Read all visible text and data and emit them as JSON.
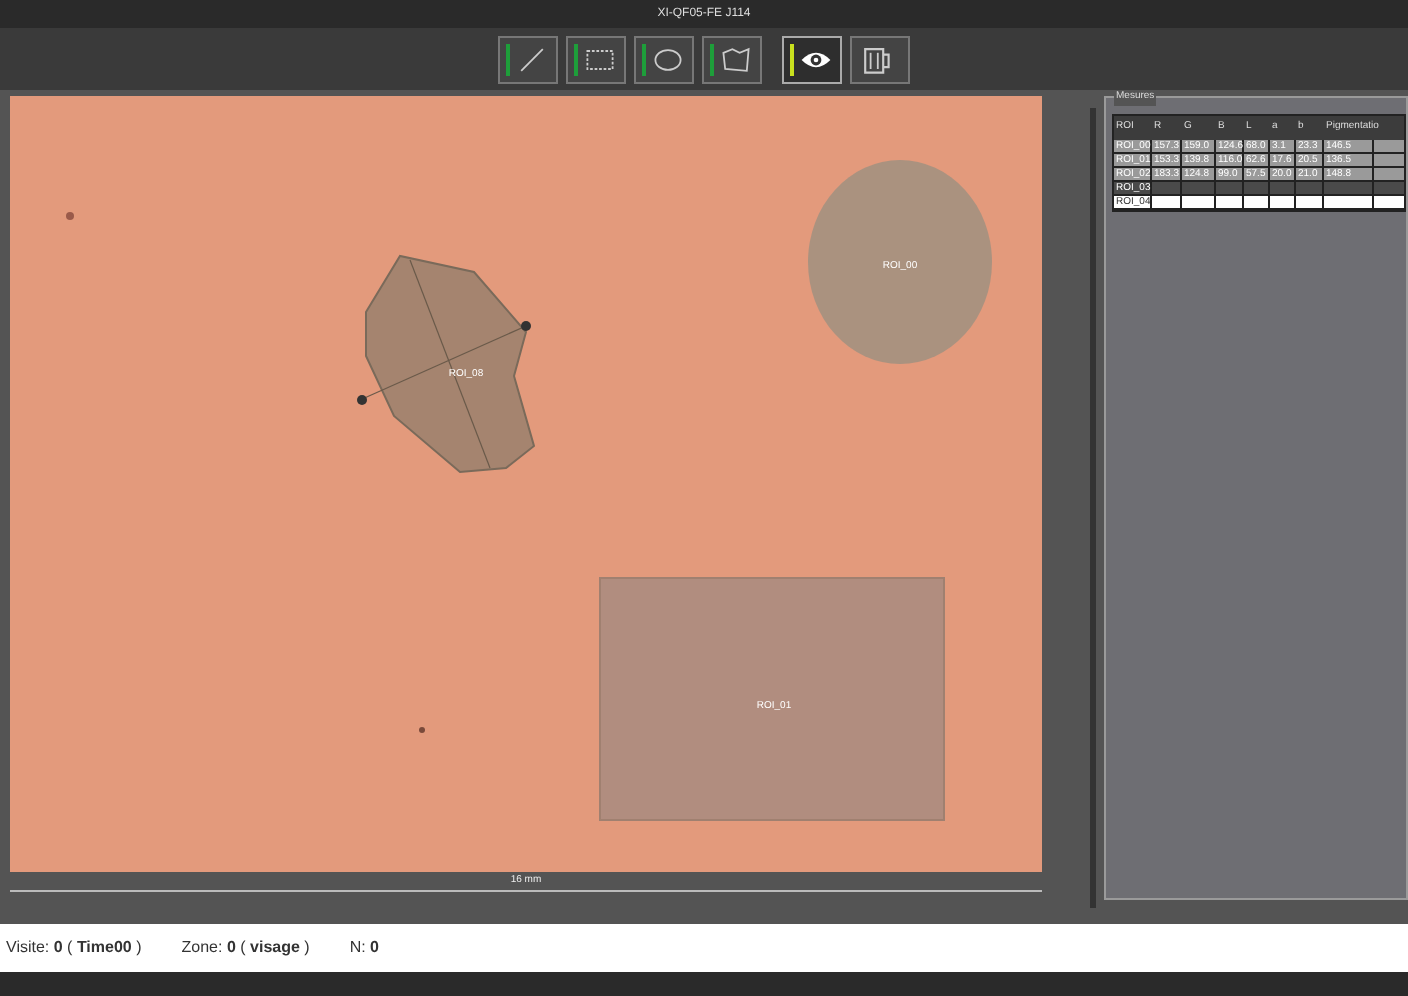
{
  "window": {
    "title": "XI-QF05-FE J114"
  },
  "toolbar": [
    {
      "kind": "line",
      "color": "#1e9e3a",
      "selected": false
    },
    {
      "kind": "rectangle",
      "color": "#1e9e3a",
      "selected": false
    },
    {
      "kind": "ellipse",
      "color": "#1e9e3a",
      "selected": false
    },
    {
      "kind": "polygon",
      "color": "#1e9e3a",
      "selected": false
    },
    {
      "kind": "eye",
      "color": "#c8e01e",
      "selected": true
    },
    {
      "kind": "trash",
      "selected": false
    }
  ],
  "image": {
    "rois": [
      {
        "kind": "polygon",
        "label": "ROI_08"
      },
      {
        "kind": "ellipse",
        "label": "ROI_00"
      },
      {
        "kind": "rectangle",
        "label": "ROI_01"
      }
    ],
    "scale_label": "16 mm"
  },
  "measures": {
    "title": "Mesures",
    "columns": [
      "ROI",
      "R",
      "G",
      "B",
      "L",
      "a",
      "b",
      "Pigmentatio"
    ],
    "rows": [
      {
        "cells": [
          "ROI_00",
          "157.3",
          "159.0",
          "124.6",
          "68.0",
          "3.1",
          "23.3",
          "146.5"
        ],
        "selected": false
      },
      {
        "cells": [
          "ROI_01",
          "153.3",
          "139.8",
          "116.0",
          "62.6",
          "17.6",
          "20.5",
          "136.5"
        ],
        "selected": false
      },
      {
        "cells": [
          "ROI_02",
          "183.3",
          "124.8",
          "99.0",
          "57.5",
          "20.0",
          "21.0",
          "148.8"
        ],
        "selected": false
      },
      {
        "cells": [
          "ROI_03"
        ],
        "selected": false
      },
      {
        "cells": [
          "ROI_04"
        ],
        "selected": true
      }
    ]
  },
  "status_bar": [
    "Visite: **0** ( **Time00** )",
    "Zone: **0** ( **visage** )",
    "N: **0**"
  ]
}
